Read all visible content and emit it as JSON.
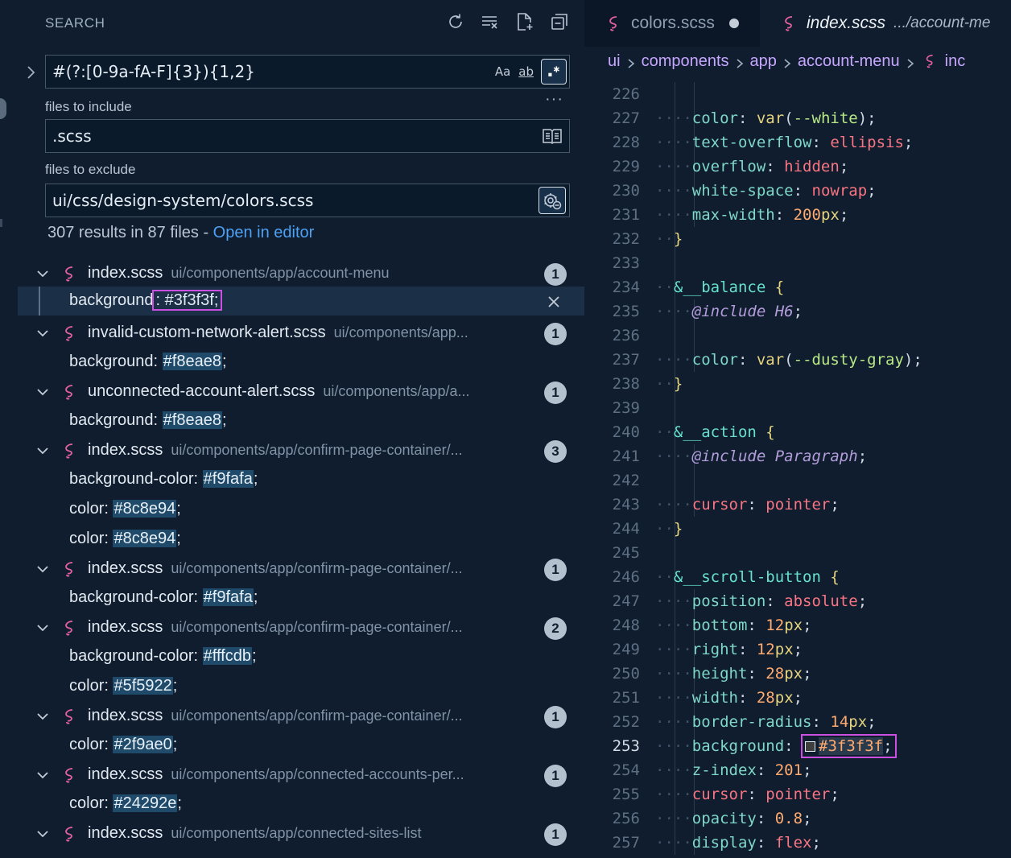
{
  "search": {
    "title": "SEARCH",
    "query": "#(?:[0-9a-fA-F]{3}){1,2}",
    "options": {
      "match_case": "Aa",
      "whole_word": "ab",
      "regex": ".*"
    },
    "more": "···",
    "include_label": "files to include",
    "include_value": ".scss",
    "exclude_label": "files to exclude",
    "exclude_value": "ui/css/design-system/colors.scss",
    "summary": "307 results in 87 files - ",
    "open_in_editor": "Open in editor"
  },
  "results": [
    {
      "file": "index.scss",
      "path": "ui/components/app/account-menu",
      "count": "1",
      "matches": [
        {
          "prefix": "background",
          "hex": "#3f3f3f",
          "suffix": ";",
          "selected": true
        }
      ]
    },
    {
      "file": "invalid-custom-network-alert.scss",
      "path": "ui/components/app...",
      "count": "1",
      "matches": [
        {
          "prefix": "background: ",
          "hex": "#f8eae8",
          "suffix": ";"
        }
      ]
    },
    {
      "file": "unconnected-account-alert.scss",
      "path": "ui/components/app/a...",
      "count": "1",
      "matches": [
        {
          "prefix": "background: ",
          "hex": "#f8eae8",
          "suffix": ";"
        }
      ]
    },
    {
      "file": "index.scss",
      "path": "ui/components/app/confirm-page-container/...",
      "count": "3",
      "matches": [
        {
          "prefix": "background-color: ",
          "hex": "#f9fafa",
          "suffix": ";"
        },
        {
          "prefix": "color: ",
          "hex": "#8c8e94",
          "suffix": ";"
        },
        {
          "prefix": "color: ",
          "hex": "#8c8e94",
          "suffix": ";"
        }
      ]
    },
    {
      "file": "index.scss",
      "path": "ui/components/app/confirm-page-container/...",
      "count": "1",
      "matches": [
        {
          "prefix": "background-color: ",
          "hex": "#f9fafa",
          "suffix": ";"
        }
      ]
    },
    {
      "file": "index.scss",
      "path": "ui/components/app/confirm-page-container/...",
      "count": "2",
      "matches": [
        {
          "prefix": "background-color: ",
          "hex": "#fffcdb",
          "suffix": ";"
        },
        {
          "prefix": "color: ",
          "hex": "#5f5922",
          "suffix": ";"
        }
      ]
    },
    {
      "file": "index.scss",
      "path": "ui/components/app/confirm-page-container/...",
      "count": "1",
      "matches": [
        {
          "prefix": "color: ",
          "hex": "#2f9ae0",
          "suffix": ";"
        }
      ]
    },
    {
      "file": "index.scss",
      "path": "ui/components/app/connected-accounts-per...",
      "count": "1",
      "matches": [
        {
          "prefix": "color: ",
          "hex": "#24292e",
          "suffix": ";"
        }
      ]
    },
    {
      "file": "index.scss",
      "path": "ui/components/app/connected-sites-list",
      "count": "1",
      "matches": []
    }
  ],
  "editor": {
    "tabs": [
      {
        "name": "colors.scss",
        "dirty": true
      },
      {
        "name": "index.scss",
        "path": ".../account-me",
        "active": true
      }
    ],
    "breadcrumb": [
      "ui",
      "components",
      "app",
      "account-menu"
    ],
    "breadcrumb_tail": "inc",
    "active_line": "253",
    "lines": [
      {
        "n": "226",
        "g": 2,
        "t": []
      },
      {
        "n": "227",
        "g": 2,
        "t": [
          [
            "p",
            "color"
          ],
          [
            "pu",
            ": "
          ],
          [
            "f",
            "var"
          ],
          [
            "pu",
            "("
          ],
          [
            "var",
            "--white"
          ],
          [
            "pu",
            ");"
          ]
        ]
      },
      {
        "n": "228",
        "g": 2,
        "t": [
          [
            "p",
            "text-overflow"
          ],
          [
            "pu",
            ": "
          ],
          [
            "v",
            "ellipsis"
          ],
          [
            "pu",
            ";"
          ]
        ]
      },
      {
        "n": "229",
        "g": 2,
        "t": [
          [
            "p",
            "overflow"
          ],
          [
            "pu",
            ": "
          ],
          [
            "v",
            "hidden"
          ],
          [
            "pu",
            ";"
          ]
        ]
      },
      {
        "n": "230",
        "g": 2,
        "t": [
          [
            "p",
            "white-space"
          ],
          [
            "pu",
            ": "
          ],
          [
            "v",
            "nowrap"
          ],
          [
            "pu",
            ";"
          ]
        ]
      },
      {
        "n": "231",
        "g": 2,
        "t": [
          [
            "p",
            "max-width"
          ],
          [
            "pu",
            ": "
          ],
          [
            "n",
            "200"
          ],
          [
            "u",
            "px"
          ],
          [
            "pu",
            ";"
          ]
        ]
      },
      {
        "n": "232",
        "g": 1,
        "t": [
          [
            "br",
            "}"
          ]
        ]
      },
      {
        "n": "233",
        "g": 1,
        "t": []
      },
      {
        "n": "234",
        "g": 1,
        "t": [
          [
            "sel",
            "&__balance"
          ],
          [
            "pu",
            " "
          ],
          [
            "br",
            "{"
          ]
        ]
      },
      {
        "n": "235",
        "g": 2,
        "t": [
          [
            "at",
            "@include"
          ],
          [
            "pu",
            " "
          ],
          [
            "mix",
            "H6"
          ],
          [
            "pu",
            ";"
          ]
        ]
      },
      {
        "n": "236",
        "g": 2,
        "t": []
      },
      {
        "n": "237",
        "g": 2,
        "t": [
          [
            "p",
            "color"
          ],
          [
            "pu",
            ": "
          ],
          [
            "f",
            "var"
          ],
          [
            "pu",
            "("
          ],
          [
            "var",
            "--dusty-gray"
          ],
          [
            "pu",
            ");"
          ]
        ]
      },
      {
        "n": "238",
        "g": 1,
        "t": [
          [
            "br",
            "}"
          ]
        ]
      },
      {
        "n": "239",
        "g": 1,
        "t": []
      },
      {
        "n": "240",
        "g": 1,
        "t": [
          [
            "sel",
            "&__action"
          ],
          [
            "pu",
            " "
          ],
          [
            "br",
            "{"
          ]
        ]
      },
      {
        "n": "241",
        "g": 2,
        "t": [
          [
            "at",
            "@include"
          ],
          [
            "pu",
            " "
          ],
          [
            "mix",
            "Paragraph"
          ],
          [
            "pu",
            ";"
          ]
        ]
      },
      {
        "n": "242",
        "g": 2,
        "t": []
      },
      {
        "n": "243",
        "g": 2,
        "t": [
          [
            "v",
            "cursor"
          ],
          [
            "pu",
            ": "
          ],
          [
            "v",
            "pointer"
          ],
          [
            "pu",
            ";"
          ]
        ]
      },
      {
        "n": "244",
        "g": 1,
        "t": [
          [
            "br",
            "}"
          ]
        ]
      },
      {
        "n": "245",
        "g": 1,
        "t": []
      },
      {
        "n": "246",
        "g": 1,
        "t": [
          [
            "sel",
            "&__scroll-button"
          ],
          [
            "pu",
            " "
          ],
          [
            "br",
            "{"
          ]
        ]
      },
      {
        "n": "247",
        "g": 2,
        "t": [
          [
            "p",
            "position"
          ],
          [
            "pu",
            ": "
          ],
          [
            "v",
            "absolute"
          ],
          [
            "pu",
            ";"
          ]
        ]
      },
      {
        "n": "248",
        "g": 2,
        "t": [
          [
            "p",
            "bottom"
          ],
          [
            "pu",
            ": "
          ],
          [
            "n",
            "12"
          ],
          [
            "u",
            "px"
          ],
          [
            "pu",
            ";"
          ]
        ]
      },
      {
        "n": "249",
        "g": 2,
        "t": [
          [
            "p",
            "right"
          ],
          [
            "pu",
            ": "
          ],
          [
            "n",
            "12"
          ],
          [
            "u",
            "px"
          ],
          [
            "pu",
            ";"
          ]
        ]
      },
      {
        "n": "250",
        "g": 2,
        "t": [
          [
            "p",
            "height"
          ],
          [
            "pu",
            ": "
          ],
          [
            "n",
            "28"
          ],
          [
            "u",
            "px"
          ],
          [
            "pu",
            ";"
          ]
        ]
      },
      {
        "n": "251",
        "g": 2,
        "t": [
          [
            "p",
            "width"
          ],
          [
            "pu",
            ": "
          ],
          [
            "n",
            "28"
          ],
          [
            "u",
            "px"
          ],
          [
            "pu",
            ";"
          ]
        ]
      },
      {
        "n": "252",
        "g": 2,
        "t": [
          [
            "p",
            "border-radius"
          ],
          [
            "pu",
            ": "
          ],
          [
            "n",
            "14"
          ],
          [
            "u",
            "px"
          ],
          [
            "pu",
            ";"
          ]
        ]
      },
      {
        "n": "253",
        "g": 2,
        "t": [
          [
            "p",
            "background"
          ],
          [
            "pu",
            ": "
          ],
          [
            "hex",
            "#3f3f3f"
          ],
          [
            "pu",
            ";"
          ]
        ]
      },
      {
        "n": "254",
        "g": 2,
        "t": [
          [
            "p",
            "z-index"
          ],
          [
            "pu",
            ": "
          ],
          [
            "n",
            "201"
          ],
          [
            "pu",
            ";"
          ]
        ]
      },
      {
        "n": "255",
        "g": 2,
        "t": [
          [
            "v",
            "cursor"
          ],
          [
            "pu",
            ": "
          ],
          [
            "v",
            "pointer"
          ],
          [
            "pu",
            ";"
          ]
        ]
      },
      {
        "n": "256",
        "g": 2,
        "t": [
          [
            "p",
            "opacity"
          ],
          [
            "pu",
            ": "
          ],
          [
            "n",
            "0.8"
          ],
          [
            "pu",
            ";"
          ]
        ]
      },
      {
        "n": "257",
        "g": 2,
        "t": [
          [
            "p",
            "display"
          ],
          [
            "pu",
            ": "
          ],
          [
            "v",
            "flex"
          ],
          [
            "pu",
            ";"
          ]
        ]
      }
    ]
  }
}
